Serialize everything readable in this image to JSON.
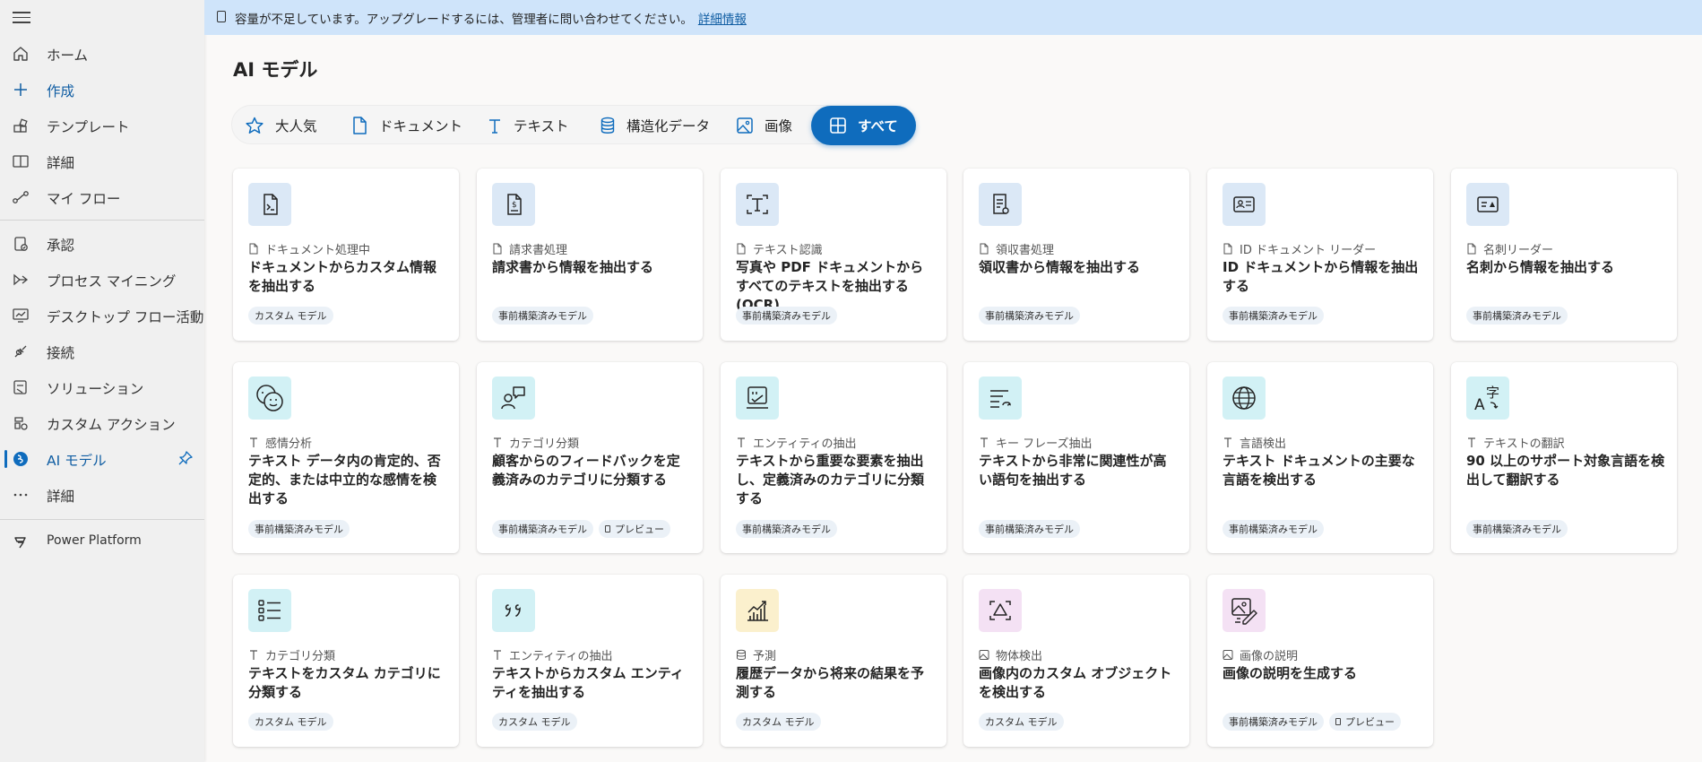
{
  "sidebar": {
    "items": [
      {
        "label": "ホーム",
        "icon": "home-icon"
      },
      {
        "label": "作成",
        "icon": "plus-icon"
      },
      {
        "label": "テンプレート",
        "icon": "template-icon"
      },
      {
        "label": "詳細",
        "icon": "book-icon"
      },
      {
        "label": "マイ フロー",
        "icon": "flow-icon"
      },
      {
        "label": "承認",
        "icon": "approvals-icon"
      },
      {
        "label": "プロセス マイニング",
        "icon": "process-mining-icon"
      },
      {
        "label": "デスクトップ フロー活動",
        "icon": "desktop-flow-icon"
      },
      {
        "label": "接続",
        "icon": "connections-icon"
      },
      {
        "label": "ソリューション",
        "icon": "solutions-icon"
      },
      {
        "label": "カスタム アクション",
        "icon": "custom-actions-icon"
      },
      {
        "label": "AI モデル",
        "icon": "ai-models-icon"
      },
      {
        "label": "詳細",
        "icon": "more-icon"
      },
      {
        "label": "Power Platform",
        "icon": "power-platform-icon"
      }
    ]
  },
  "banner": {
    "message": "容量が不足しています。アップグレードするには、管理者に問い合わせてください。",
    "link": "詳細情報"
  },
  "page": {
    "title": "AI モデル"
  },
  "tabs": [
    {
      "label": "大人気",
      "icon": "star-icon"
    },
    {
      "label": "ドキュメント",
      "icon": "document-icon"
    },
    {
      "label": "テキスト",
      "icon": "text-icon"
    },
    {
      "label": "構造化データ",
      "icon": "database-icon"
    },
    {
      "label": "画像",
      "icon": "image-icon"
    },
    {
      "label": "すべて",
      "icon": "grid-icon",
      "selected": true
    }
  ],
  "cards": [
    {
      "category": "ドキュメント処理中",
      "title": "ドキュメントからカスタム情報を抽出する",
      "tags": [
        "カスタム モデル"
      ],
      "icon": "document-process-icon"
    },
    {
      "category": "請求書処理",
      "title": "請求書から情報を抽出する",
      "tags": [
        "事前構築済みモデル"
      ],
      "icon": "invoice-icon"
    },
    {
      "category": "テキスト認識",
      "title": "写真や PDF ドキュメントからすべてのテキストを抽出する (OCR)",
      "tags": [
        "事前構築済みモデル"
      ],
      "icon": "text-recognition-icon"
    },
    {
      "category": "領収書処理",
      "title": "領収書から情報を抽出する",
      "tags": [
        "事前構築済みモデル"
      ],
      "icon": "receipt-icon"
    },
    {
      "category": "ID ドキュメント リーダー",
      "title": "ID ドキュメントから情報を抽出する",
      "tags": [
        "事前構築済みモデル"
      ],
      "icon": "id-card-icon"
    },
    {
      "category": "名刺リーダー",
      "title": "名刺から情報を抽出する",
      "tags": [
        "事前構築済みモデル"
      ],
      "icon": "business-card-icon"
    },
    {
      "category": "感情分析",
      "title": "テキスト データ内の肯定的、否定的、または中立的な感情を検出する",
      "tags": [
        "事前構築済みモデル"
      ],
      "icon": "sentiment-icon"
    },
    {
      "category": "カテゴリ分類",
      "title": "顧客からのフィードバックを定義済みのカテゴリに分類する",
      "tags": [
        "事前構築済みモデル",
        "プレビュー"
      ],
      "icon": "feedback-icon"
    },
    {
      "category": "エンティティの抽出",
      "title": "テキストから重要な要素を抽出し、定義済みのカテゴリに分類する",
      "tags": [
        "事前構築済みモデル"
      ],
      "icon": "entity-extraction-icon"
    },
    {
      "category": "キー フレーズ抽出",
      "title": "テキストから非常に関連性が高い語句を抽出する",
      "tags": [
        "事前構築済みモデル"
      ],
      "icon": "key-phrase-icon"
    },
    {
      "category": "言語検出",
      "title": "テキスト ドキュメントの主要な言語を検出する",
      "tags": [
        "事前構築済みモデル"
      ],
      "icon": "globe-icon"
    },
    {
      "category": "テキストの翻訳",
      "title": "90 以上のサポート対象言語を検出して翻訳する",
      "tags": [
        "事前構築済みモデル"
      ],
      "icon": "translate-icon"
    },
    {
      "category": "カテゴリ分類",
      "title": "テキストをカスタム カテゴリに分類する",
      "tags": [
        "カスタム モデル"
      ],
      "icon": "list-icon"
    },
    {
      "category": "エンティティの抽出",
      "title": "テキストからカスタム エンティティを抽出する",
      "tags": [
        "カスタム モデル"
      ],
      "icon": "quote-icon"
    },
    {
      "category": "予測",
      "title": "履歴データから将来の結果を予測する",
      "tags": [
        "カスタム モデル"
      ],
      "icon": "prediction-chart-icon"
    },
    {
      "category": "物体検出",
      "title": "画像内のカスタム オブジェクトを検出する",
      "tags": [
        "カスタム モデル"
      ],
      "icon": "object-detection-icon"
    },
    {
      "category": "画像の説明",
      "title": "画像の説明を生成する",
      "tags": [
        "事前構築済みモデル",
        "プレビュー"
      ],
      "icon": "image-description-icon"
    }
  ]
}
